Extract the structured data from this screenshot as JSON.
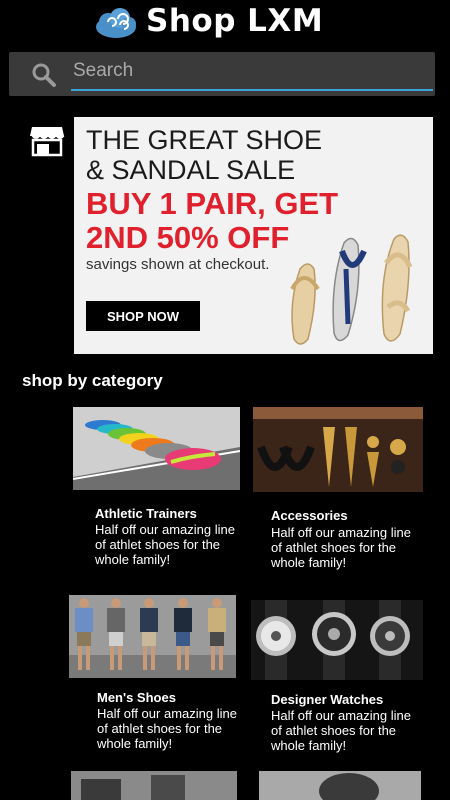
{
  "header": {
    "title": "Shop LXM",
    "logo_icon": "cloud-logo-icon"
  },
  "search": {
    "placeholder": "Search",
    "value": "",
    "icon": "search-icon",
    "underline_color": "#3aa2d8"
  },
  "store_icon": "store-icon",
  "banner": {
    "line1": "THE GREAT SHOE",
    "line2": "& SANDAL SALE",
    "line3": "BUY 1 PAIR, GET",
    "line4": "2ND 50% OFF",
    "line5": "savings shown at checkout.",
    "button_label": "SHOP NOW",
    "accent_color": "#e0202c"
  },
  "section": {
    "heading": "shop by category"
  },
  "categories": [
    {
      "title": "Athletic Trainers",
      "description": "Half off our amazing line of athlet shoes for the whole family!"
    },
    {
      "title": "Accessories",
      "description": "Half off our amazing line of athlet shoes for the whole family!"
    },
    {
      "title": "Men's Shoes",
      "description": "Half off our amazing line of athlet shoes for the whole family!"
    },
    {
      "title": "Designer Watches",
      "description": "Half off our amazing line of athlet shoes for the whole family!"
    }
  ]
}
